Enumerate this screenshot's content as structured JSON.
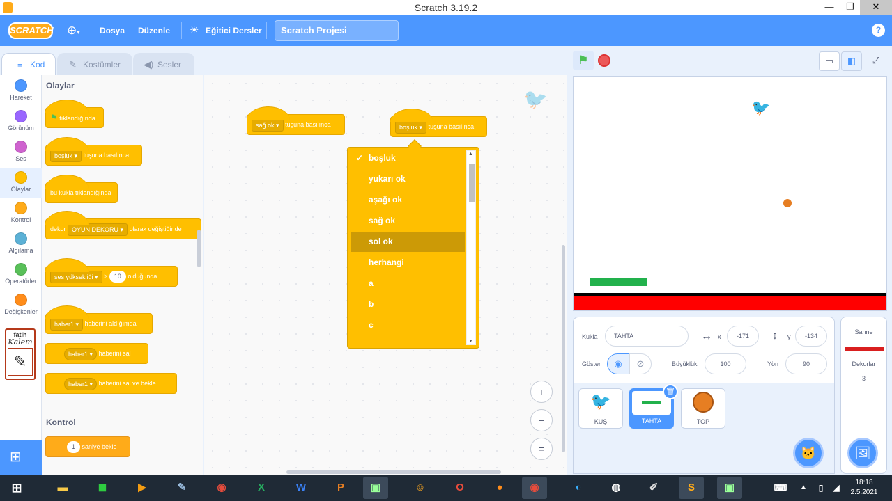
{
  "window": {
    "title": "Scratch 3.19.2"
  },
  "menu": {
    "logo": "SCRATCH",
    "file": "Dosya",
    "edit": "Düzenle",
    "tutorials": "Eğitici Dersler",
    "project_title": "Scratch Projesi",
    "help": "?"
  },
  "tabs": [
    {
      "label": "Kod"
    },
    {
      "label": "Kostümler"
    },
    {
      "label": "Sesler"
    }
  ],
  "categories": [
    {
      "label": "Hareket",
      "color": "#4c97ff"
    },
    {
      "label": "Görünüm",
      "color": "#9966ff"
    },
    {
      "label": "Ses",
      "color": "#cf63cf"
    },
    {
      "label": "Olaylar",
      "color": "#ffbf00"
    },
    {
      "label": "Kontrol",
      "color": "#ffab19"
    },
    {
      "label": "Algılama",
      "color": "#5cb1d6"
    },
    {
      "label": "Operatörler",
      "color": "#59c059"
    },
    {
      "label": "Değişkenler",
      "color": "#ff8c1a"
    }
  ],
  "extension": {
    "line1": "fatih",
    "line2": "Kalem"
  },
  "palette": {
    "events_title": "Olaylar",
    "flag_clicked": "tıklandığında",
    "key_dd": "boşluk",
    "key_pressed": "tuşuna basılınca",
    "sprite_clicked": "bu kukla tıklandığında",
    "backdrop_prefix": "dekor",
    "backdrop_dd": "OYUN DEKORU",
    "backdrop_suffix": "olarak değiştiğinde",
    "loudness_dd": "ses yüksekliği",
    "gt": ">",
    "loudness_val": "10",
    "loudness_suffix": "olduğunda",
    "msg1_dd": "haber1",
    "msg1_text": "haberini aldığımda",
    "msg2_dd": "haber1",
    "msg2_text": "haberini sal",
    "msg3_dd": "haber1",
    "msg3_text": "haberini sal ve bekle",
    "control_title": "Kontrol",
    "wait_val": "1",
    "wait_text": "saniye bekle"
  },
  "script": {
    "block1_dd": "sağ ok",
    "block1_text": "tuşuna basılınca",
    "block2_dd": "boşluk",
    "block2_text": "tuşuna basılınca"
  },
  "dropdown": {
    "options": [
      "boşluk",
      "yukarı ok",
      "aşağı ok",
      "sağ ok",
      "sol ok",
      "herhangi",
      "a",
      "b",
      "c"
    ],
    "checked_index": 0,
    "highlighted_index": 4,
    "check_mark": "✓"
  },
  "zoom": {
    "in": "+",
    "out": "−",
    "reset": "="
  },
  "sprite_info": {
    "sprite_label": "Kukla",
    "sprite_name": "TAHTA",
    "x_symbol": "x",
    "x": "-171",
    "y_symbol": "y",
    "y": "-134",
    "show_label": "Göster",
    "size_label": "Büyüklük",
    "size": "100",
    "direction_label": "Yön",
    "direction": "90"
  },
  "sprites": [
    {
      "name": "KUŞ"
    },
    {
      "name": "TAHTA"
    },
    {
      "name": "TOP"
    }
  ],
  "stage_pane": {
    "title": "Sahne",
    "backdrops_label": "Dekorlar",
    "backdrops_count": "3"
  },
  "stage_colors": {
    "floor": "#ff0000",
    "paddle": "#22b14c",
    "ball": "#e67e22"
  },
  "clock": {
    "time": "18:18",
    "date": "2.5.2021"
  }
}
